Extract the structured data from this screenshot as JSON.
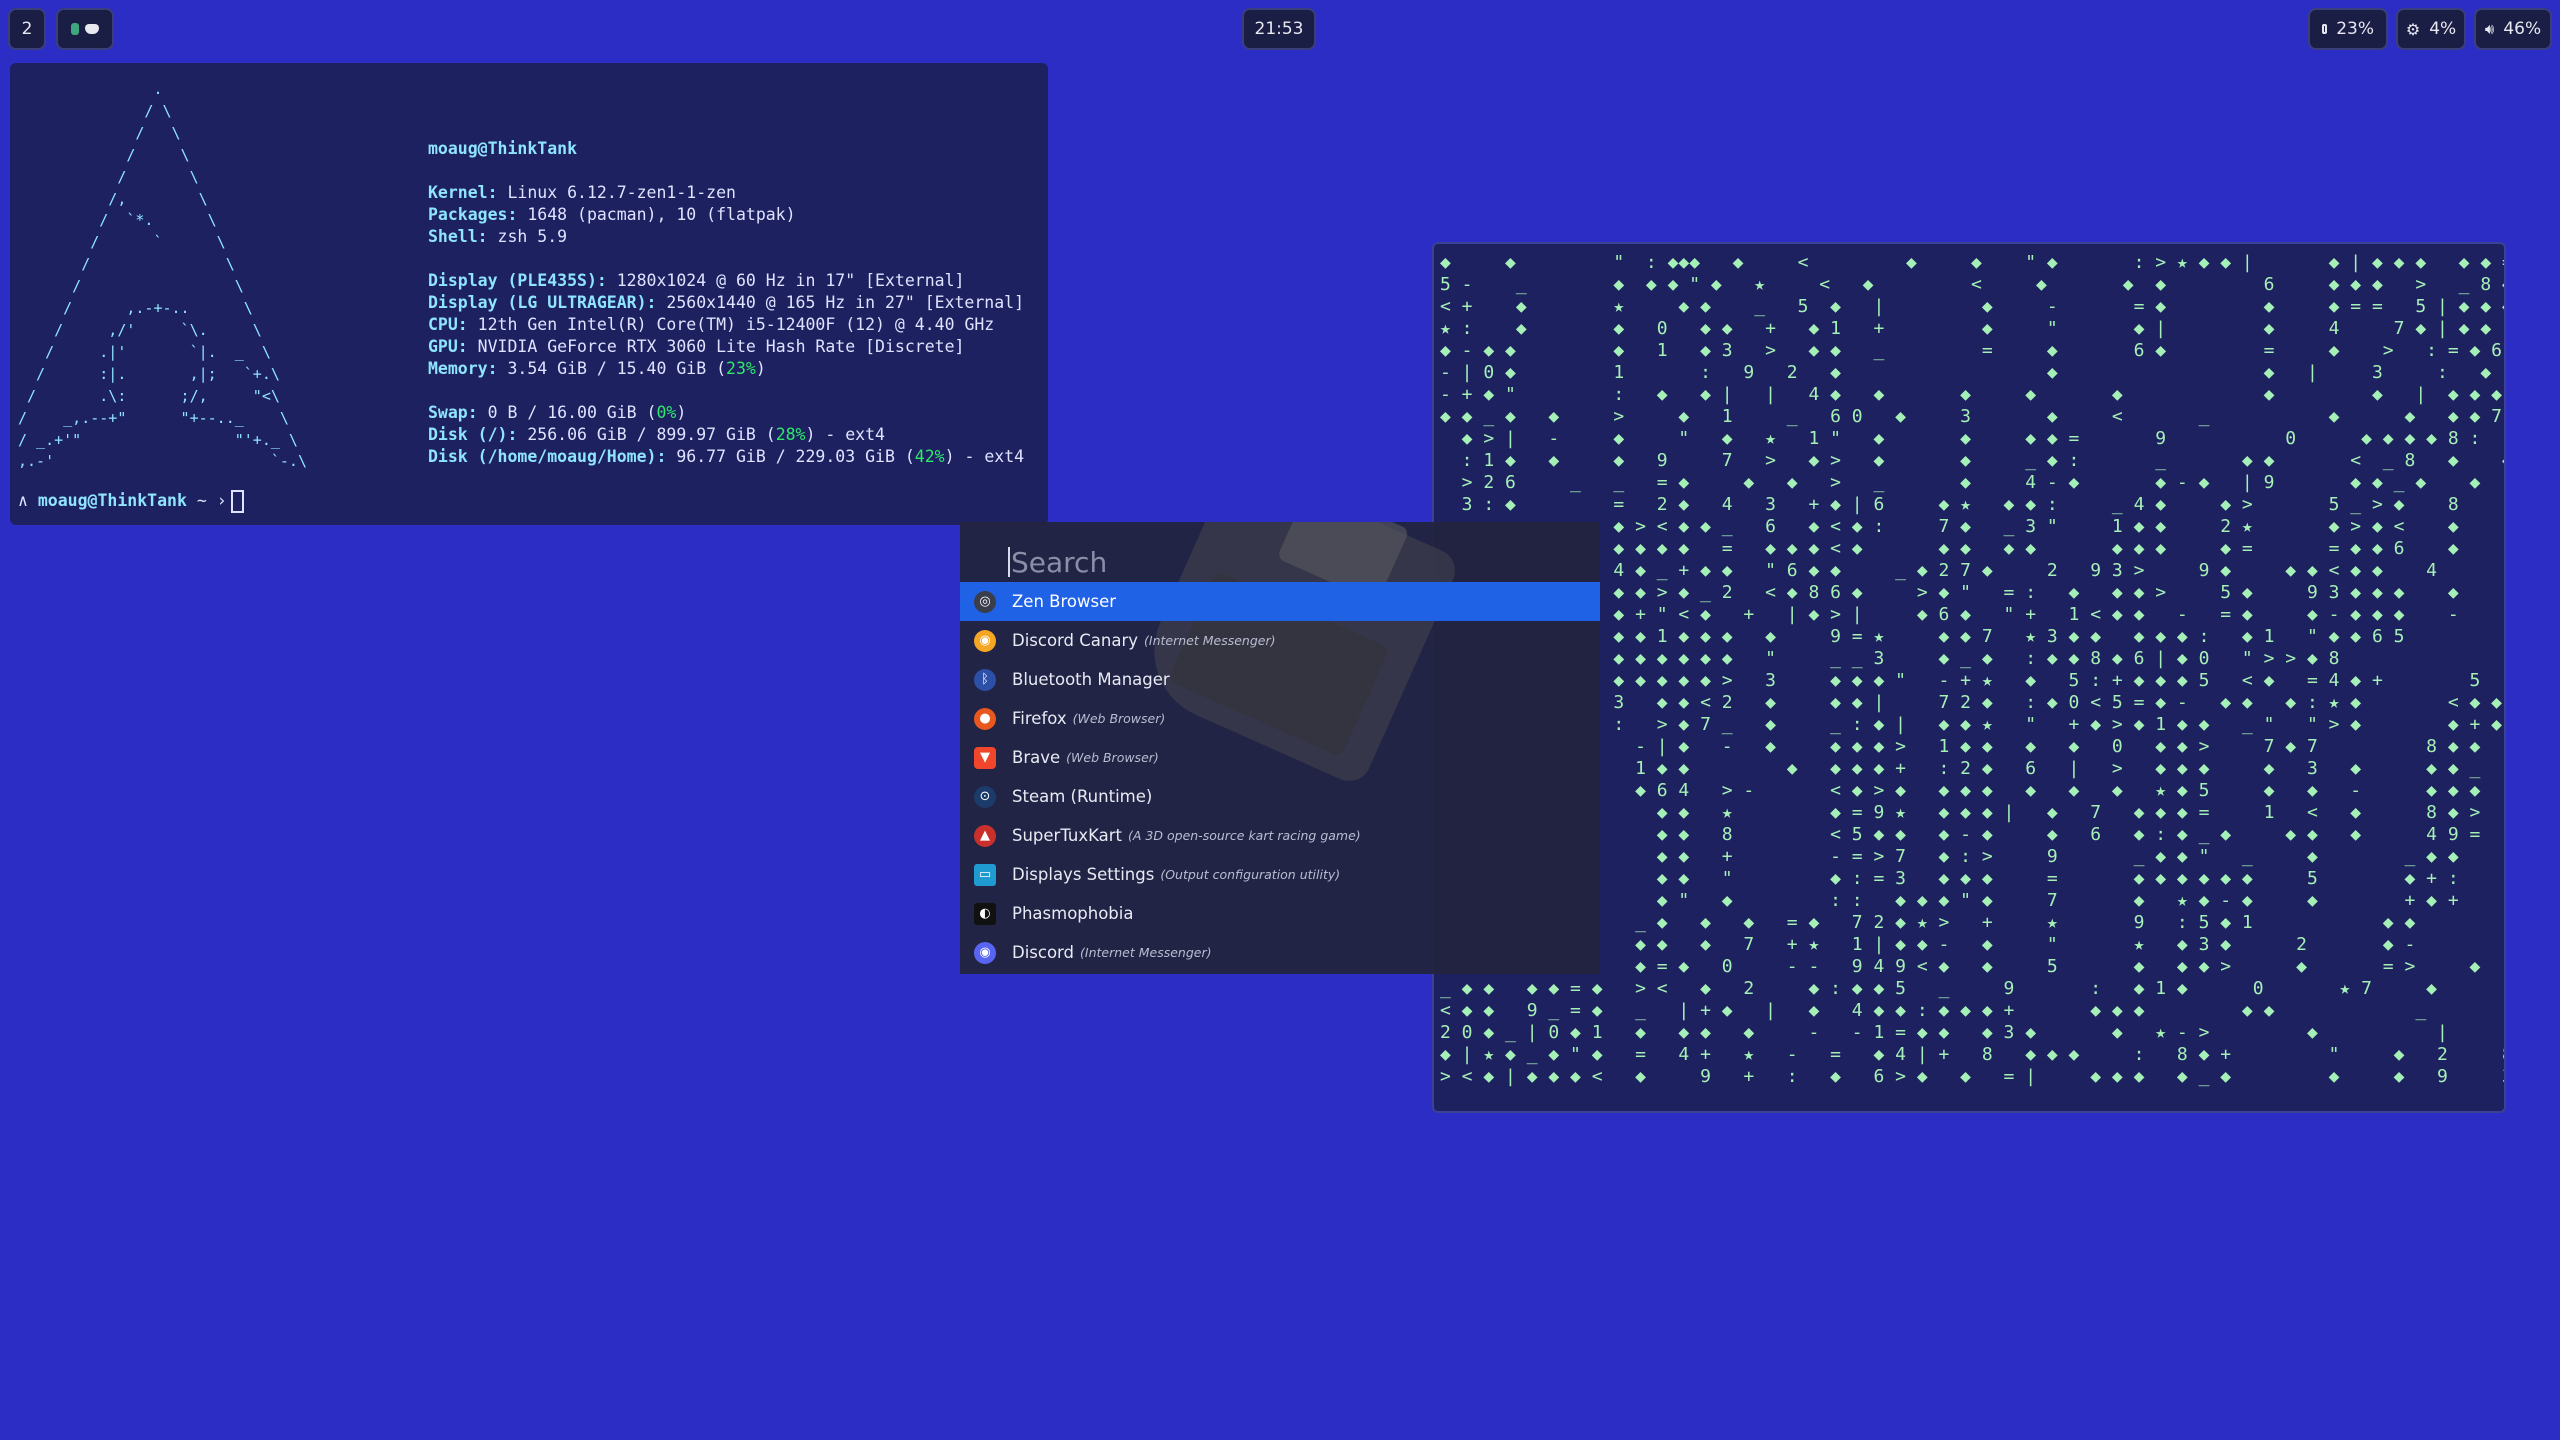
{
  "topbar": {
    "workspace": "2",
    "clock": "21:53",
    "status": [
      {
        "icon": "memory-icon",
        "value": "23%"
      },
      {
        "icon": "cpu-icon",
        "value": "4%"
      },
      {
        "icon": "volume-icon",
        "value": "46%"
      }
    ]
  },
  "fetch": {
    "ascii_art": "               .\n              / \\\n             /   \\\n            /     \\\n           /       \\\n          /,        \\\n         /  `*.      \\\n        /      `      \\\n       /               \\\n      /                 \\\n     /      ,.-+-..      \\\n    /     ,/'     `\\.     \\\n   /     .|'       `|.  _  \\\n  /      :|.       ,|;   `+.\\\n /       .\\:      ;/,     \"<\\\n/    _,.--+\"      \"+--.._    \\\n/ _.+'\"                 \"'+._ \\\n,.-'                        `-.\\",
    "user_host": "moaug@ThinkTank",
    "lines": [
      {
        "label": "Kernel:",
        "value": " Linux 6.12.7-zen1-1-zen"
      },
      {
        "label": "Packages:",
        "value": " 1648 (pacman), 10 (flatpak)"
      },
      {
        "label": "Shell:",
        "value": " zsh 5.9"
      },
      {
        "label": "Display (PLE435S):",
        "value": " 1280x1024 @ 60 Hz in 17\" [External]"
      },
      {
        "label": "Display (LG ULTRAGEAR):",
        "value": " 2560x1440 @ 165 Hz in 27\" [External]"
      },
      {
        "label": "CPU:",
        "value": " 12th Gen Intel(R) Core(TM) i5-12400F (12) @ 4.40 GHz"
      },
      {
        "label": "GPU:",
        "value": " NVIDIA GeForce RTX 3060 Lite Hash Rate [Discrete]"
      },
      {
        "label": "Memory:",
        "value": " 3.54 GiB / 15.40 GiB (",
        "pct": "23%",
        "tail": ")"
      },
      {
        "label": "Swap:",
        "value": " 0 B / 16.00 GiB (",
        "pct": "0%",
        "tail": ")"
      },
      {
        "label": "Disk (/):",
        "value": " 256.06 GiB / 899.97 GiB (",
        "pct": "28%",
        "tail": ") - ext4"
      },
      {
        "label": "Disk (/home/moaug/Home):",
        "value": " 96.77 GiB / 229.03 GiB (",
        "pct": "42%",
        "tail": ") - ext4"
      }
    ],
    "prompt_user": "moaug@ThinkTank",
    "prompt_prefix": "∧",
    "prompt_suffix": "~ ›"
  },
  "matrix_text": "◆     ◆         \"  : ◆◆◆   ◆     <         ◆     ◆    \" ◆       : > ★ ◆ ◆ |       ◆ | ◆ ◆ ◆   ◆ ◆ =\n5 -    _        ◆  ◆ ◆ \" ◆   ★     <   ◆         <     ◆       ◆  ◆         6     ◆ ◆ ◆   >   _ 8 ◆ ◆ 8   ◆ ◆\n< +    ◆        ★     ◆ ◆    _   5  ◆   |         ◆     -       = ◆         ◆     ◆ = =   5 | ◆ ◆ ◆   ◆   ◆\n★ :    ◆        ◆   0   ◆ ◆   +   ◆ 1   +         ◆     \"       ◆ |         ◆     4     7 ◆ | ◆ ◆   4     +\n◆ - ◆ ◆         ◆   1   ◆ 3   >   ◆ ◆   _         =     ◆       6 ◆         =     ◆    >   : = ◆ 6 :   6     ◆\n- | 0 ◆         1       :   9   2   ◆                   ◆                   ◆   |     3     :   ◆ : ◆ ◆ ◆   >     ◆\n- + ◆ \"         :   ◆   ◆ |   |   4 ◆   ◆       ◆     ◆       ◆             ◆         ◆   |  ◆ ◆ ◆    9 ◆     :\n◆ ◆ _ ◆   ◆     >     ◆   1     _   6 0   ◆     3       ◆     <       _           ◆      ◆   ◆ ◆ 7 ◆    3 ◆     ◆\n  ◆ > |   -     ◆     \"   ◆   ★   1 \"   ◆       ◆     ◆ ◆ =       9           0      ◆ ◆ ◆ ◆ 8 :    2 ◆     \"\n  : 1 ◆   ◆     ◆   9     7   >   ◆ >   ◆       ◆     _ ◆ :       _       ◆ ◆       <  _ 8   ◆    ◆ ◆     _\n  > 2 6     _   _   = ◆     ◆   ◆   >   _       ◆     4 - ◆       ◆ - ◆   | 9       ◆ ◆ _ ◆    ◆   | =\n  3 : ◆         =   2 ◆   4   3   + ◆ | 6     ◆ ★   ◆ ◆ :     _ 4 ◆     ◆ >       5 _ > ◆    8     8 >\n                ◆ > < ◆ ◆ _   6   ◆ < ◆ :     7 ◆   _ 3 \"     1 ◆ ◆     2 ★       ◆ > ◆ <    ◆       = 1\n                ◆ ◆ ◆ ◆   =   ◆ ◆ ◆ < ◆       ◆ ◆   ◆ ◆       ◆ ◆ ◆     ◆ =       = ◆ ◆ 6    ◆     ◆\n                4 ◆ _ + ◆ ◆   \" 6 ◆ ◆     _ ◆ 2 7 ◆     2   9 3 >     9 ◆     ◆ ◆ < ◆ ◆    4       ◆ ◆\n                ◆ ◆ > ◆ _ 2   < ◆ 8 6 ◆     > ◆ \"   = :   ◆   ◆ ◆ >     5 ◆     9 3 ◆ ◆ ◆    ◆     +\n                ◆ + \" < ◆   +   | ◆ > |     ◆ 6 ◆   \" +   1 < ◆ ◆   -   = ◆     ◆ - ◆ ◆ ◆    -     ◆\n                ◆ ◆ 1 ◆ ◆ ◆   ◆     9 = ★     ◆ ◆ 7   ★ 3 ◆ ◆   ◆ ◆ ◆ :   ◆ 1   \" ◆ ◆ 6 5\n                ◆ ◆ ◆ ◆ ◆ ◆   \"     _ _ 3     ◆ _ ◆   : ◆ ◆ 8 ◆ 6 | ◆ 0   \" > > ◆ 8\n                ◆ ◆ ◆ ◆ ◆ >   3     ◆ ◆ ◆ \"   - + ★   ◆   5 : + ◆ ◆ ◆ 5   < ◆   = 4 ◆ +        5\n                3   ◆ ◆ < 2   ◆     ◆ ◆ |     7 2 ◆   : ◆ 0 < 5 = ◆ -   ◆ ◆   ◆ : ★ ◆        < ◆ ◆\n                :   > ◆ 7 _   ◆     _ : ◆ |   ◆ ◆ ★   \"   + ◆ > ◆ 1 ◆ ◆   _ \"   \" > ◆        ◆ + ◆\n                  - | ◆   -   ◆     ◆ ◆ ◆ >   1 ◆ ◆   ◆   ◆   0   ◆ ◆ >     7 ◆ 7          8 ◆ ◆\n                  1 ◆ ◆         ◆   ◆ ◆ ◆ +   : 2 ◆   6   |   >   ◆ ◆ ◆     ◆   3   ◆      ◆ ◆ _\n                  ◆ 6 4   > -       < ◆ > ◆   ◆ ◆ ◆   ◆   ◆   ◆   ★ ◆ 5     ◆   ◆   -      ◆ ◆ ◆\n                    ◆ ◆   ★         ◆ = 9 ★   ◆ ◆ ◆ |   ◆   7   ◆ ◆ ◆ =     1   <   ◆      8 ◆ >\n                    ◆ ◆   8         < 5 ◆ ◆   ◆ - ◆     ◆   6   ◆ : ◆ _ ◆     ◆ ◆   ◆      4 9 =\n                    ◆ ◆   +         - = > 7   ◆ : >     9       _ ◆ ◆ \"   _     ◆        _ ◆ ◆\n                    ◆ ◆   \"         ◆ : = 3   ◆ ◆ ◆     =       ◆ ◆ ◆ ◆ ◆ ◆     5        ◆ + :\n                    ◆ \"   ◆         : :   ◆ ◆ ◆ \" ◆     7       ◆   ★ ◆ - ◆     ◆        + ◆ +\n                  _ ◆   ◆   ◆   = ◆   7 2 ◆ ★ >   +     ★       9   : 5 ◆ 1            ◆ ◆\n                  ◆ ◆   ◆   7   + ★   1 | ◆ ◆ -   ◆     \"       ★   ◆ 3 ◆      2       ◆ -\n                  ◆ = ◆   0     - -   9 4 9 < ◆   ◆     5       ◆   ◆ ◆ >      ◆       = >     ◆\n_ ◆ ◆   ◆ ◆ = ◆   > <   ◆   2     ◆ : ◆ ◆ 5   _     9       :   ◆ 1 ◆      0       ★ 7     ◆\n< ◆ ◆   9 _ = ◆   _   | + ◆   |   ◆   4 ◆ ◆ : ◆ ◆ ◆ +       ◆ ◆ ◆         ◆ ◆             _\n2 0 ◆ _ | 0 ◆ 1   ◆   ◆ ◆   ◆     -   - 1 = ◆ ◆   ◆ 3 ◆       ◆   ★ - >         ◆           |\n◆ | ★ ◆ _ ◆ \" ◆   =   4 +   ★   -   =   ◆ 4 | +   8   ◆ ◆ ◆     :   8 ◆ +         \"     ◆   2     8\n> < ◆ | ◆ ◆ ◆ <   ◆     9   +   :   ◆   6 > ◆   ◆   = |     ◆ ◆ ◆   ◆ _ ◆         ◆     ◆   9     3",
  "launcher": {
    "search_placeholder": "Search",
    "results": [
      {
        "name": "Zen Browser",
        "desc": "",
        "icon": "zen-browser-icon",
        "color": "#3a3d4a",
        "glyph": "◎",
        "selected": true
      },
      {
        "name": "Discord Canary",
        "desc": "(Internet Messenger)",
        "icon": "discord-canary-icon",
        "color": "#f5a623",
        "glyph": "◉",
        "selected": false
      },
      {
        "name": "Bluetooth Manager",
        "desc": "",
        "icon": "bluetooth-icon",
        "color": "#2c4fa8",
        "glyph": "ᛒ",
        "selected": false
      },
      {
        "name": "Firefox",
        "desc": "(Web Browser)",
        "icon": "firefox-icon",
        "color": "#e8571e",
        "glyph": "●",
        "selected": false
      },
      {
        "name": "Brave",
        "desc": "(Web Browser)",
        "icon": "brave-icon",
        "color": "#f0462c",
        "glyph": "▼",
        "selected": false
      },
      {
        "name": "Steam (Runtime)",
        "desc": "",
        "icon": "steam-icon",
        "color": "#1b3b6b",
        "glyph": "⊙",
        "selected": false
      },
      {
        "name": "SuperTuxKart",
        "desc": "(A 3D open-source kart racing game)",
        "icon": "supertuxkart-icon",
        "color": "#c9302c",
        "glyph": "▲",
        "selected": false
      },
      {
        "name": "Displays Settings",
        "desc": "(Output configuration utility)",
        "icon": "display-settings-icon",
        "color": "#1f9bd1",
        "glyph": "▭",
        "selected": false
      },
      {
        "name": "Phasmophobia",
        "desc": "",
        "icon": "phasmophobia-icon",
        "color": "#111111",
        "glyph": "◐",
        "selected": false
      },
      {
        "name": "Discord",
        "desc": "(Internet Messenger)",
        "icon": "discord-icon",
        "color": "#5865f2",
        "glyph": "◉",
        "selected": false
      }
    ]
  },
  "colors": {
    "desktop": "#2c2dc4",
    "terminal": "#1d2160",
    "accent_cyan": "#8fe4ff",
    "accent_green": "#2ee86a",
    "selection": "#1f62e6"
  }
}
